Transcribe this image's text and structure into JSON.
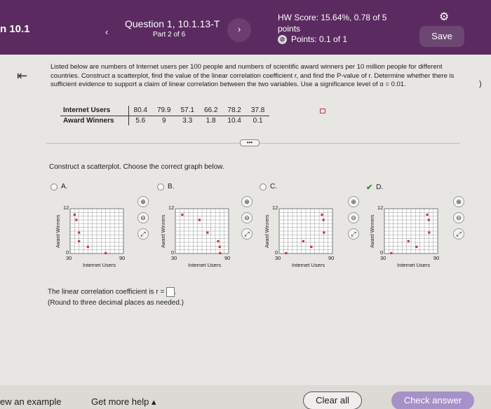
{
  "header": {
    "section": "n 10.1",
    "prev_icon": "chevron-left",
    "question_title": "Question 1, 10.1.13-T",
    "question_part": "Part 2 of 6",
    "next_icon": "chevron-right",
    "hw_score": "HW Score: 15.64%, 0.78 of 5",
    "hw_points_word": "points",
    "points": "Points: 0.1 of 1",
    "settings_icon": "gear",
    "save_label": "Save"
  },
  "intro_text": "Listed below are numbers of Internet users per 100 people and numbers of scientific award winners per 10 million people for different countries. Construct a scatterplot, find the value of the linear correlation coefficient r, and find the P-value of r. Determine whether there is sufficient evidence to support a claim of linear correlation between the two variables. Use a significance level of α = 0.01.",
  "data_table": {
    "row1_label": "Internet Users",
    "row1": [
      "80.4",
      "79.9",
      "57.1",
      "66.2",
      "78.2",
      "37.8"
    ],
    "row2_label": "Award Winners",
    "row2": [
      "5.6",
      "9",
      "3.3",
      "1.8",
      "10.4",
      "0.1"
    ]
  },
  "more_label": "•••",
  "construct_text": "Construct a scatterplot. Choose the correct graph below.",
  "options": [
    {
      "label": "A."
    },
    {
      "label": "B."
    },
    {
      "label": "C."
    },
    {
      "label": "D.",
      "checked": true
    }
  ],
  "graph_labels": {
    "y_label": "Award Winners",
    "x_label": "Internet Users",
    "y_max": "12",
    "y_min": "0",
    "x_min": "30",
    "x_max": "90"
  },
  "graph_points": {
    "A": [
      [
        35,
        10.4
      ],
      [
        37,
        9.0
      ],
      [
        40,
        5.6
      ],
      [
        40,
        3.3
      ],
      [
        50,
        1.8
      ],
      [
        70,
        0.1
      ]
    ],
    "B": [
      [
        37.8,
        10.4
      ],
      [
        57.1,
        9.0
      ],
      [
        66.2,
        5.6
      ],
      [
        78.2,
        3.3
      ],
      [
        79.9,
        1.8
      ],
      [
        80.4,
        0.1
      ]
    ],
    "C": [
      [
        37.8,
        0.1
      ],
      [
        57.1,
        3.3
      ],
      [
        66.2,
        1.8
      ],
      [
        78.2,
        10.4
      ],
      [
        79.9,
        9.0
      ],
      [
        80.4,
        5.6
      ]
    ],
    "D": [
      [
        37.8,
        0.1
      ],
      [
        57.1,
        3.3
      ],
      [
        66.2,
        1.8
      ],
      [
        78.2,
        10.4
      ],
      [
        79.9,
        9.0
      ],
      [
        80.4,
        5.6
      ]
    ]
  },
  "correlation_text": "The linear correlation coefficient is r =",
  "round_text": "(Round to three decimal places as needed.)",
  "footer": {
    "view_example": "ew an example",
    "get_more_help": "Get more help ▴",
    "clear_all": "Clear all",
    "check_answer": "Check answer"
  },
  "colors": {
    "header_bg": "#5b2a60",
    "point_color": "#c23b4b",
    "check_answer_bg": "#a691c8"
  }
}
